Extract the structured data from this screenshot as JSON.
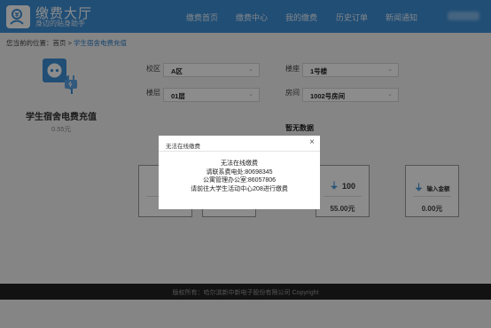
{
  "header": {
    "brand_title": "缴费大厅",
    "brand_sub": "身边的贴身助手",
    "nav": [
      "缴费首页",
      "缴费中心",
      "我的缴费",
      "历史订单",
      "新闻通知"
    ]
  },
  "breadcrumb": {
    "prefix": "您当前的位置：首页 > ",
    "current": "学生宿舍电费充值"
  },
  "product": {
    "title": "学生宿舍电费充值",
    "balance": "0.55元"
  },
  "form": {
    "campus_label": "校区",
    "campus_value": "A区",
    "building_label": "楼座",
    "building_value": "1号楼",
    "floor_label": "楼层",
    "floor_value": "01层",
    "room_label": "房间",
    "room_value": "1002号房间",
    "no_data": "暂无数据"
  },
  "cards": [
    {
      "amount": "100",
      "price": "55.00元"
    },
    {
      "amount": "输入金额",
      "price": "0.00元"
    }
  ],
  "modal": {
    "title": "无法在线缴费",
    "close": "×",
    "lines": [
      "无法在线缴费",
      "请联系费电处:80698345",
      "公寓管理办公室:86057806",
      "请前往大学生活动中心208进行缴费"
    ]
  },
  "footer": {
    "text": "版权所有：哈尔滨新中新电子股份有限公司 Copyright"
  },
  "colors": {
    "brand": "#3c8ed6",
    "footer_bg": "#222222"
  }
}
